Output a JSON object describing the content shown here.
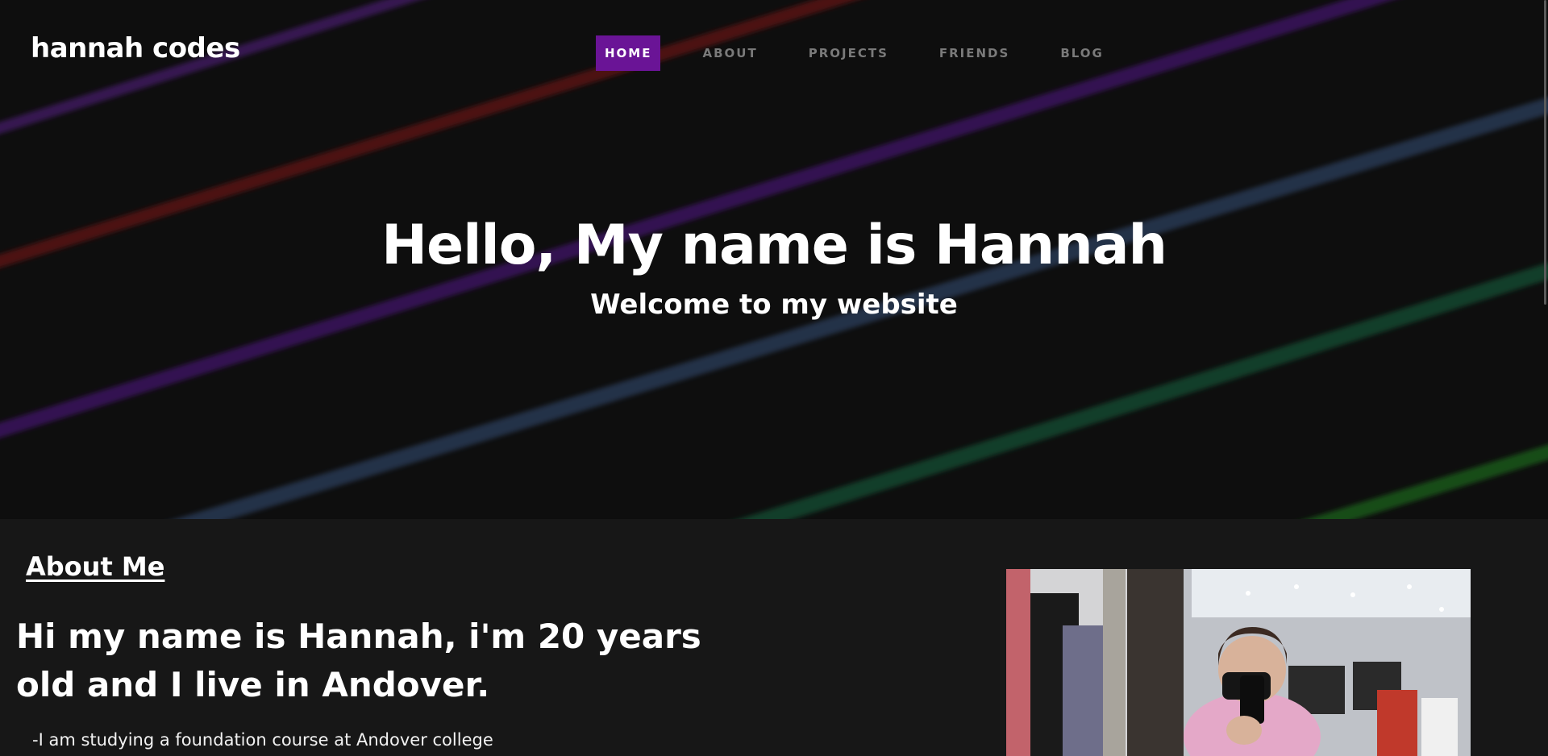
{
  "site": {
    "logo": "hannah codes"
  },
  "nav": {
    "items": [
      {
        "label": "HOME",
        "active": true
      },
      {
        "label": "ABOUT"
      },
      {
        "label": "PROJECTS"
      },
      {
        "label": "FRIENDS"
      },
      {
        "label": "BLOG"
      }
    ]
  },
  "hero": {
    "title": "Hello, My name is Hannah",
    "subtitle": "Welcome to my website"
  },
  "about": {
    "heading": "About Me",
    "intro": "Hi my name is Hannah, i'm 20 years old and I live in Andover.",
    "lines": [
      "-I am studying a foundation course at Andover college"
    ]
  },
  "colors": {
    "accent": "#6a1496",
    "background": "#171717",
    "hero_background": "#111111",
    "nav_inactive": "#7a7a7a"
  }
}
